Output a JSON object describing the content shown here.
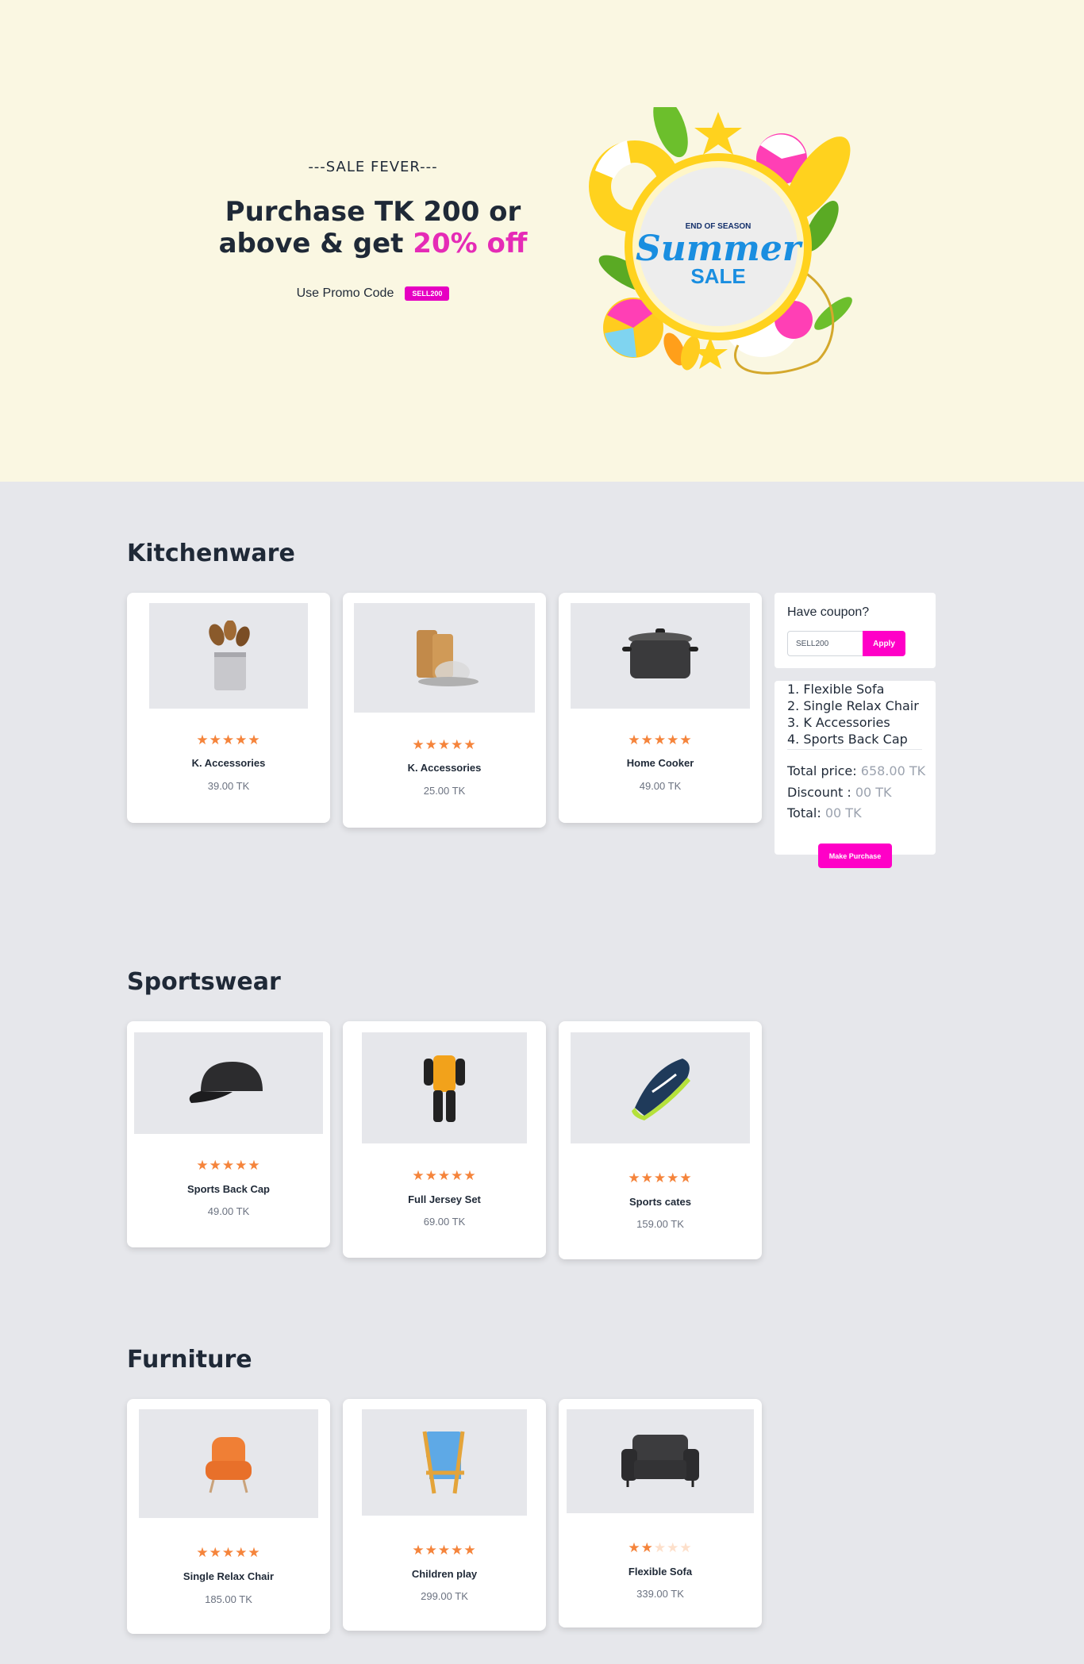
{
  "hero": {
    "eyebrow": "---SALE FEVER---",
    "title_line1": "Purchase TK 200 or",
    "title_line2_prefix": "above & get ",
    "title_highlight": "20% off",
    "promo_label": "Use Promo Code",
    "promo_code": "SELL200",
    "art": {
      "top_line": "END OF SEASON",
      "script": "Summer",
      "bottom_line": "SALE"
    }
  },
  "sections": [
    {
      "title": "Kitchenware",
      "products": [
        {
          "name": "K. Accessories",
          "price": "39.00 TK",
          "rating": 5,
          "icon": "utensil-holder-icon"
        },
        {
          "name": "K. Accessories",
          "price": "25.00 TK",
          "rating": 5,
          "icon": "cutting-board-icon"
        },
        {
          "name": "Home Cooker",
          "price": "49.00 TK",
          "rating": 5,
          "icon": "cooking-pot-icon"
        }
      ]
    },
    {
      "title": "Sportswear",
      "products": [
        {
          "name": "Sports Back Cap",
          "price": "49.00 TK",
          "rating": 5,
          "icon": "cap-icon"
        },
        {
          "name": "Full Jersey Set",
          "price": "69.00 TK",
          "rating": 5,
          "icon": "jersey-icon"
        },
        {
          "name": "Sports cates",
          "price": "159.00 TK",
          "rating": 5,
          "icon": "sneaker-icon"
        }
      ]
    },
    {
      "title": "Furniture",
      "products": [
        {
          "name": "Single Relax Chair",
          "price": "185.00 TK",
          "rating": 5,
          "icon": "armchair-icon"
        },
        {
          "name": "Children play",
          "price": "299.00 TK",
          "rating": 5,
          "icon": "folding-chair-icon"
        },
        {
          "name": "Flexible Sofa",
          "price": "339.00 TK",
          "rating": 2,
          "icon": "sofa-icon"
        }
      ]
    }
  ],
  "coupon": {
    "label": "Have coupon?",
    "input_value": "SELL200",
    "apply_label": "Apply"
  },
  "cart": {
    "items": [
      "1. Flexible Sofa",
      "2. Single Relax Chair",
      "3. K Accessories",
      "4. Sports Back Cap"
    ],
    "total_price_label": "Total price:",
    "total_price_value": "658.00 TK",
    "discount_label": "Discount :",
    "discount_value": "00 TK",
    "total_label": "Total:",
    "total_value": "00 TK",
    "purchase_label": "Make Purchase"
  },
  "colors": {
    "accent": "#ff00c7",
    "highlight": "#e52bb6",
    "star": "#f5843b",
    "hero_bg": "#faf7e2",
    "page_bg": "#e6e7eb"
  }
}
